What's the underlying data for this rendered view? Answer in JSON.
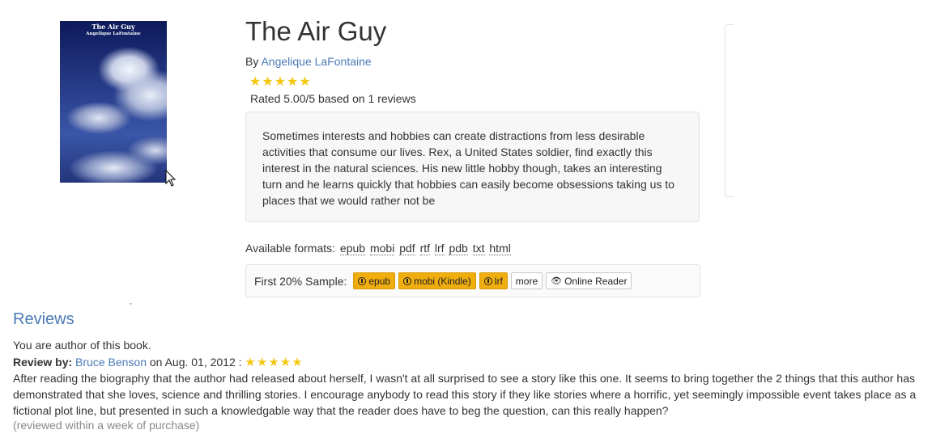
{
  "book": {
    "title": "The Air Guy",
    "by_label": "By",
    "author": "Angelique LaFontaine",
    "stars": "★★★★★",
    "rating_text": "Rated 5.00/5 based on 1 reviews",
    "description": "Sometimes interests and hobbies can create distractions from less desirable activities that consume our lives. Rex, a United States soldier, find exactly this interest in the natural sciences. His new little hobby though, takes an interesting turn and he learns quickly that hobbies can easily become obsessions taking us to places that we would rather not be"
  },
  "cover": {
    "title": "The Air Guy",
    "author": "Angelique LaFontaine"
  },
  "formats": {
    "label": "Available formats:",
    "items": [
      "epub",
      "mobi",
      "pdf",
      "rtf",
      "lrf",
      "pdb",
      "txt",
      "html"
    ]
  },
  "sample": {
    "label": "First 20% Sample:",
    "buttons": [
      "epub",
      "mobi (Kindle)",
      "lrf"
    ],
    "more": "more",
    "online_reader": "Online Reader"
  },
  "reviews": {
    "heading": "Reviews",
    "author_note": "You are author of this book.",
    "review_by_label": "Review by:",
    "reviewer": "Bruce Benson",
    "date_text": "on Aug. 01, 2012 :",
    "stars": "★★★★★",
    "body": "After reading the biography that the author had released about herself, I wasn't at all surprised to see a story like this one. It seems to bring together the 2 things that this author has demonstrated that she loves, science and thrilling stories. I encourage anybody to read this story if they like stories where a horrific, yet seemingly impossible event takes place as a fictional plot line, but presented in such a knowledgable way that the reader does have to beg the question, can this really happen?",
    "note": "(reviewed within a week of purchase)"
  },
  "colors": {
    "link": "#4a7ab5",
    "star": "#f2c811",
    "warning_button": "#f0ad0e"
  }
}
